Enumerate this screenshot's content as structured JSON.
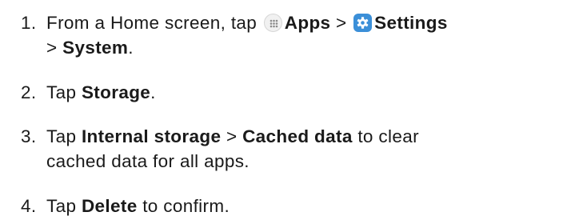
{
  "steps": [
    {
      "number": "1.",
      "text_1": "From a Home screen, tap",
      "apps_icon": "apps-grid-icon",
      "apps_label": "Apps",
      "separator_1": ">",
      "settings_icon": "settings-gear-icon",
      "settings_label": "Settings",
      "separator_2": ">",
      "system_label": "System",
      "period": "."
    },
    {
      "number": "2.",
      "text_1": "Tap",
      "storage_label": "Storage",
      "period": "."
    },
    {
      "number": "3.",
      "text_1": "Tap",
      "internal_storage_label": "Internal storage",
      "separator": ">",
      "cached_data_label": "Cached data",
      "text_2": "to clear",
      "text_3": "cached data for all apps."
    },
    {
      "number": "4.",
      "text_1": "Tap",
      "delete_label": "Delete",
      "text_2": "to confirm."
    }
  ],
  "colors": {
    "text": "#1a1a1a",
    "settings_icon_bg": "#3b8fd8",
    "apps_icon_bg": "#f1f1f1"
  }
}
